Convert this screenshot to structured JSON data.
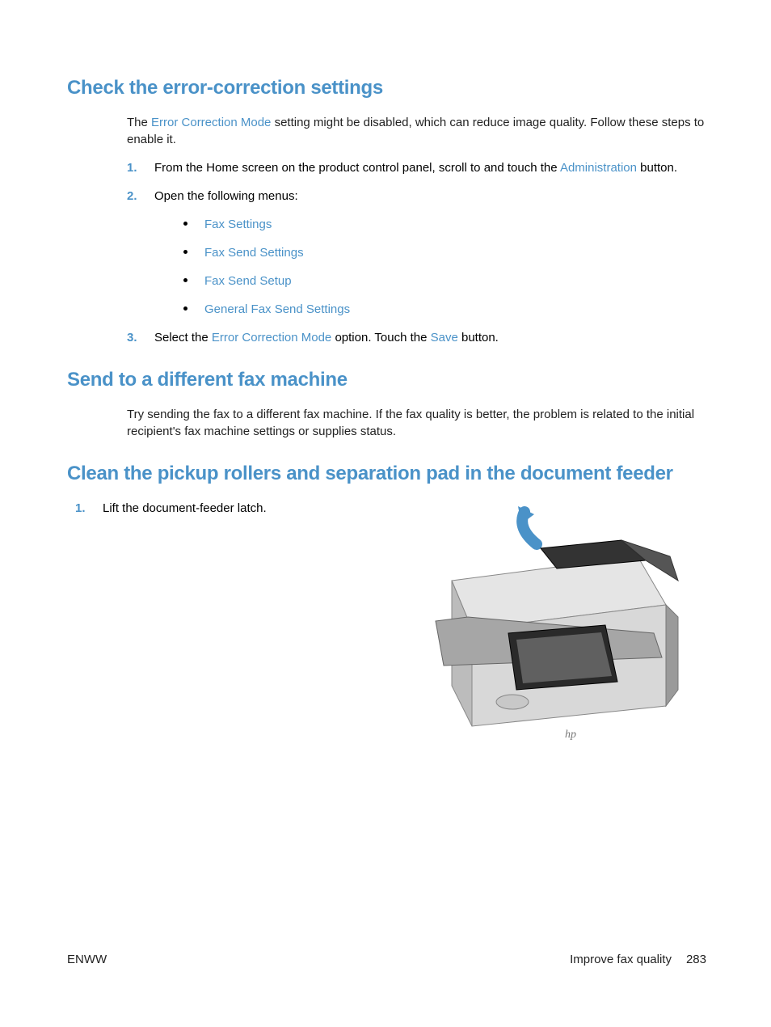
{
  "s1": {
    "heading": "Check the error-correction settings",
    "intro_a": "The ",
    "intro_link": "Error Correction Mode",
    "intro_b": " setting might be disabled, which can reduce image quality. Follow these steps to enable it.",
    "step1_num": "1.",
    "step1_a": "From the Home screen on the product control panel, scroll to and touch the ",
    "step1_link": "Administration",
    "step1_b": " button.",
    "step2_num": "2.",
    "step2_text": "Open the following menus:",
    "menus": {
      "m1": "Fax Settings",
      "m2": "Fax Send Settings",
      "m3": "Fax Send Setup",
      "m4": "General Fax Send Settings"
    },
    "step3_num": "3.",
    "step3_a": "Select the ",
    "step3_link1": "Error Correction Mode",
    "step3_b": " option. Touch the ",
    "step3_link2": "Save",
    "step3_c": " button."
  },
  "s2": {
    "heading": "Send to a different fax machine",
    "text": "Try sending the fax to a different fax machine. If the fax quality is better, the problem is related to the initial recipient's fax machine settings or supplies status."
  },
  "s3": {
    "heading": "Clean the pickup rollers and separation pad in the document feeder",
    "step1_num": "1.",
    "step1_text": "Lift the document-feeder latch."
  },
  "footer": {
    "left": "ENWW",
    "right_section": "Improve fax quality",
    "right_page": "283"
  }
}
